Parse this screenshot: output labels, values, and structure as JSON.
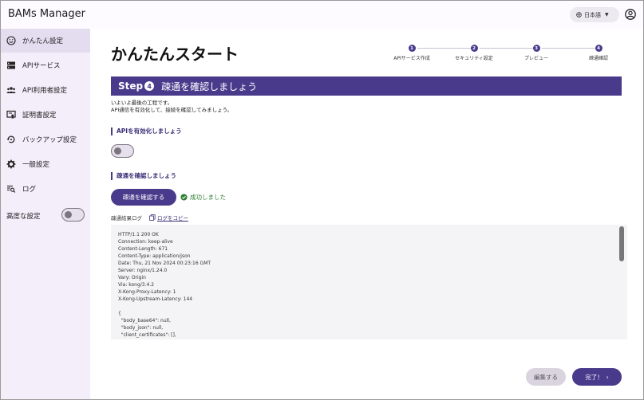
{
  "app": {
    "title": "BAMs Manager"
  },
  "header": {
    "language": "日本語"
  },
  "sidebar": {
    "items": [
      {
        "label": "かんたん設定",
        "icon": "smiley-icon",
        "active": true
      },
      {
        "label": "APIサービス",
        "icon": "server-icon",
        "active": false
      },
      {
        "label": "API利用者設定",
        "icon": "users-icon",
        "active": false
      },
      {
        "label": "証明書設定",
        "icon": "certificate-icon",
        "active": false
      },
      {
        "label": "バックアップ設定",
        "icon": "backup-restore-icon",
        "active": false
      },
      {
        "label": "一般設定",
        "icon": "gear-icon",
        "active": false
      },
      {
        "label": "ログ",
        "icon": "log-search-icon",
        "active": false
      }
    ],
    "advanced_label": "高度な設定",
    "advanced_enabled": false
  },
  "main": {
    "title": "かんたんスタート",
    "stepper": [
      {
        "num": "1",
        "label": "APIサービス作成"
      },
      {
        "num": "2",
        "label": "セキュリティ設定"
      },
      {
        "num": "3",
        "label": "プレビュー"
      },
      {
        "num": "4",
        "label": "疎通確認"
      }
    ],
    "banner": {
      "step_word": "Step",
      "step_num": "4",
      "title": "疎通を確認しましょう"
    },
    "intro": [
      "いよいよ最後の工程です。",
      "API通信を有効化して、接続を確認してみましょう。"
    ],
    "enable_api": {
      "heading": "APIを有効化しましょう",
      "enabled": false
    },
    "connectivity": {
      "heading": "疎通を確認しましょう",
      "button": "疎通を確認する",
      "status": "成功しました"
    },
    "log": {
      "label": "疎通結果ログ",
      "copy": "ログをコピー",
      "lines": [
        "HTTP/1.1 200 OK",
        "Connection: keep-alive",
        "Content-Length: 671",
        "Content-Type: application/json",
        "Date: Thu, 21 Nov 2024 00:23:16 GMT",
        "Server: nginx/1.24.0",
        "Vary: Origin",
        "Via: kong/3.4.2",
        "X-Kong-Proxy-Latency: 1",
        "X-Kong-Upstream-Latency: 144",
        "",
        "{",
        "  \"body_base64\": null,",
        "  \"body_json\": null,",
        "  \"client_certificates\": [],"
      ]
    },
    "actions": {
      "edit": "編集する",
      "done": "完了！"
    }
  },
  "colors": {
    "primary": "#4a3a8c",
    "sidebar_bg": "#f3eef9",
    "success": "#2e7d32"
  }
}
